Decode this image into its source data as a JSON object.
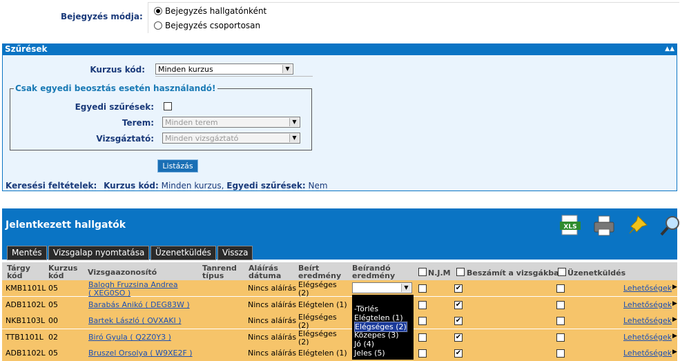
{
  "mode": {
    "label": "Bejegyzés módja:",
    "options": [
      "Bejegyzés hallgatónként",
      "Bejegyzés csoportosan"
    ],
    "selected": 0
  },
  "filters": {
    "title": "Szűrések",
    "collapse_icon": "double-chevron-up-icon",
    "course_label": "Kurzus kód:",
    "course_value": "Minden kurzus",
    "fieldset_title": "Csak egyedi beosztás esetén használandó!",
    "custom_label": "Egyedi szűrések:",
    "room_label": "Terem:",
    "room_value": "Minden terem",
    "examiner_label": "Vizsgáztató:",
    "examiner_value": "Minden vizsgáztató",
    "list_button": "Listázás",
    "criteria_label": "Keresési feltételek:",
    "criteria_course_label": "Kurzus kód:",
    "criteria_course_value": "Minden kurzus,",
    "criteria_custom_label": "Egyedi szűrések:",
    "criteria_custom_value": "Nem"
  },
  "grid": {
    "title": "Jelentkezett hallgatók",
    "tabs": [
      "Mentés",
      "Vizsgalap nyomtatása",
      "Üzenetküldés",
      "Vissza"
    ],
    "headers": {
      "subject_1": "Tárgy",
      "subject_2": "kód",
      "course_1": "Kurzus",
      "course_2": "kód",
      "exam_id": "Vizsgaazonosító",
      "schedule_1": "Tanrend",
      "schedule_2": "típus",
      "sign_1": "Aláírás",
      "sign_2": "dátuma",
      "entered_1": "Beírt",
      "entered_2": "eredmény",
      "toenter_1": "Beírandó",
      "toenter_2": "eredmény",
      "njm": "N.J.M",
      "count": "Beszámít a vizsgákba",
      "message": "Üzenetküldés"
    },
    "rows": [
      {
        "subject": "KMB1101L",
        "course": "05",
        "name": "Balogh Fruzsina Andrea",
        "code": "( XEG0SO )",
        "sign": "Nincs aláírás",
        "result_1": "Elégséges",
        "result_2": "(2)",
        "njm": false,
        "count": true,
        "msg": false,
        "options": "Lehetőségek"
      },
      {
        "subject": "ADB1102L",
        "course": "05",
        "name": "Barabás Anikó ( DEG83W )",
        "code": "",
        "sign": "Nincs aláírás",
        "result_1": "Elégtelen (1)",
        "result_2": "",
        "njm": false,
        "count": true,
        "msg": false,
        "options": "Lehetőségek"
      },
      {
        "subject": "NKB1103L",
        "course": "00",
        "name": "Bartek László ( OVXAKI )",
        "code": "",
        "sign": "Nincs aláírás",
        "result_1": "Elégséges",
        "result_2": "(2)",
        "njm": false,
        "count": true,
        "msg": false,
        "options": "Lehetőségek"
      },
      {
        "subject": "TTB1101L",
        "course": "02",
        "name": "Biró Gyula ( Q2Z0Y3 )",
        "code": "",
        "sign": "Nincs aláírás",
        "result_1": "Elégséges",
        "result_2": "(2)",
        "njm": false,
        "count": true,
        "msg": false,
        "options": "Lehetőségek"
      },
      {
        "subject": "ADB1102L",
        "course": "05",
        "name": "Bruszel Orsolya ( W9XE2F )",
        "code": "",
        "sign": "Nincs aláírás",
        "result_1": "Elégtelen (1)",
        "result_2": "",
        "njm": false,
        "count": true,
        "msg": false,
        "options": "Lehetőségek"
      }
    ],
    "dropdown_options": [
      "-Törlés",
      "Elégtelen (1)",
      "Elégséges (2)",
      "Közepes (3)",
      "Jó (4)",
      "Jeles (5)"
    ],
    "dropdown_selected": 2,
    "icons": [
      "xls-export-icon",
      "print-icon",
      "pin-icon",
      "search-icon"
    ],
    "xls_text": "XLS"
  }
}
